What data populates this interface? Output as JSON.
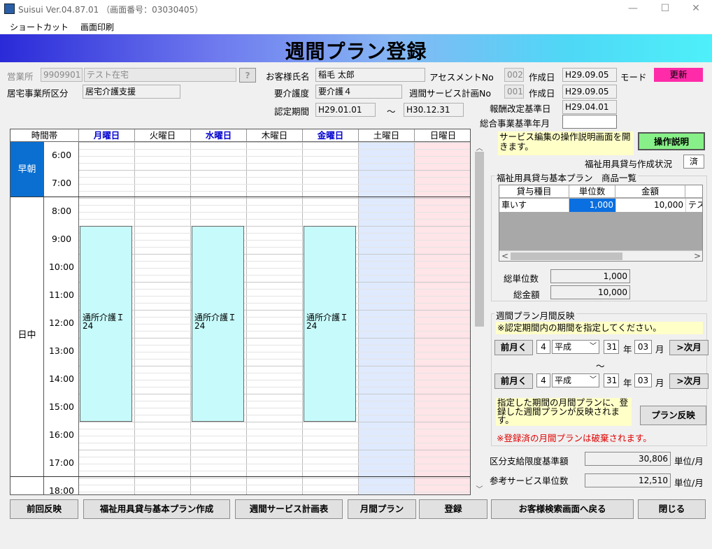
{
  "window": {
    "title": "Suisui Ver.04.87.01 （画面番号：03030405）",
    "min": "—",
    "max": "☐",
    "close": "✕"
  },
  "menu": [
    "ショートカット",
    "画面印刷"
  ],
  "banner": {
    "title": "週間プラン登録"
  },
  "form": {
    "office_label": "営業所",
    "office_code": "9909901",
    "office_name": "テスト在宅",
    "office_lookup": "?",
    "home_office_type_label": "居宅事業所区分",
    "home_office_type": "居宅介護支援",
    "customer_name_label": "お客様氏名",
    "customer_name": "稲毛 太郎",
    "care_level_label": "要介護度",
    "care_level": "要介護４",
    "cert_period_label": "認定期間",
    "cert_from": "H29.01.01",
    "cert_sep": "〜",
    "cert_to": "H30.12.31",
    "assessment_label": "アセスメントNo",
    "assessment_no": "002",
    "weekly_plan_label": "週間サービス計画No",
    "weekly_plan_no": "001",
    "created_label_1": "作成日",
    "created_date_1": "H29.09.05",
    "created_label_2": "作成日",
    "created_date_2": "H29.09.05",
    "mode_label": "モード",
    "mode_value": "更新",
    "fee_revision_label": "報酬改定基準日",
    "fee_revision_date": "H29.04.01",
    "combined_base_label": "総合事業基準年月",
    "combined_base_value": ""
  },
  "grid": {
    "header_time": "時間帯",
    "days": [
      "月曜日",
      "火曜日",
      "水曜日",
      "木曜日",
      "金曜日",
      "土曜日",
      "日曜日"
    ],
    "periods": [
      "早朝",
      "日中"
    ],
    "times": [
      "6:00",
      "7:00",
      "8:00",
      "9:00",
      "10:00",
      "11:00",
      "12:00",
      "13:00",
      "14:00",
      "15:00",
      "16:00",
      "17:00",
      "18:00"
    ],
    "services": [
      {
        "day": "月曜日",
        "label": "通所介護Ｉ\n24"
      },
      {
        "day": "水曜日",
        "label": "通所介護Ｉ\n24"
      },
      {
        "day": "金曜日",
        "label": "通所介護Ｉ\n24"
      }
    ],
    "scroll_up": "︿",
    "scroll_down": "﹀"
  },
  "panel": {
    "help_text": "サービス編集の操作説明画面を開きます。",
    "help_button": "操作説明",
    "welfare_status_label": "福祉用具貸与作成状況",
    "welfare_status_value": "済",
    "welfare_group_title": "福祉用具貸与基本プラン　商品一覧",
    "welfare_table": {
      "headers": [
        "貸与種目",
        "単位数",
        "金額",
        ""
      ],
      "rows": [
        [
          "車いす",
          "1,000",
          "10,000",
          "テス"
        ]
      ]
    },
    "total_units_label": "総単位数",
    "total_units": "1,000",
    "total_amount_label": "総金額",
    "total_amount": "10,000",
    "monthly_group_title": "週間プラン月間反映",
    "monthly_note": "※認定期間内の期間を指定してください。",
    "from": {
      "prev": "前月く",
      "month": "4",
      "era": "平成",
      "year": "31",
      "year_label": "年",
      "mon": "03",
      "mon_label": "月",
      "next": ">次月"
    },
    "range_sep": "〜",
    "to": {
      "prev": "前月く",
      "month": "4",
      "era": "平成",
      "year": "31",
      "year_label": "年",
      "mon": "03",
      "mon_label": "月",
      "next": ">次月"
    },
    "reflect_text": "指定した期間の月間プランに、登録した週間プランが反映されます。",
    "reflect_button": "プラン反映",
    "warning": "※登録済の月間プランは破棄されます。",
    "limit_label": "区分支給限度基準額",
    "limit_value": "30,806",
    "limit_unit": "単位/月",
    "ref_label": "参考サービス単位数",
    "ref_value": "12,510",
    "ref_unit": "単位/月"
  },
  "footer": [
    "前回反映",
    "福祉用具貸与基本プラン作成",
    "週間サービス計画表",
    "月間プラン",
    "登録",
    "お客様検索画面へ戻る",
    "閉じる"
  ],
  "colors": {
    "banner_start": "#2a2ad8",
    "banner_end": "#4ef0fa",
    "mode_bg": "#ff2ba8",
    "help_btn": "#88f088",
    "service_block": "#c7fafa",
    "sat_bg": "#dfeaff",
    "sun_bg": "#ffe4e8",
    "period_blue": "#0a6fd0"
  }
}
